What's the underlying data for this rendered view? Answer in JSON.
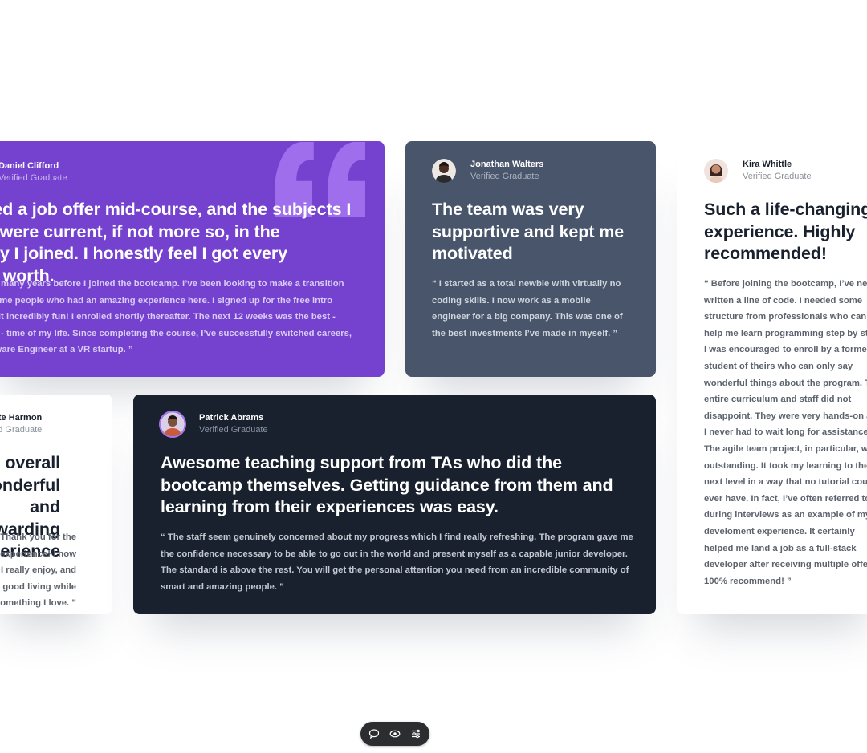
{
  "testimonials": {
    "daniel": {
      "name": "Daniel Clifford",
      "role": "Verified Graduate",
      "headline": "I received a job offer mid-course, and the subjects I learned were current, if not more so, in the company I joined. I honestly feel I got every penny’s worth.",
      "body": "“ I was an EMT for many years before I joined the bootcamp. I’ve been looking to make a transition and have heard some people who had an amazing experience here. I signed up for the free intro course and found it incredibly fun! I enrolled shortly thereafter. The next 12 weeks was the best - and most grueling - time of my life. Since completing the course, I’ve successfully switched careers, working as a Software Engineer at a VR startup. ”"
    },
    "jonathan": {
      "name": "Jonathan Walters",
      "role": "Verified Graduate",
      "headline": "The team was very supportive and kept me motivated",
      "body": "“ I started as a total newbie with virtually no coding skills. I now work as a mobile engineer for a big company. This was one of the best investments I’ve made in myself. ”"
    },
    "jeanette": {
      "name": "Jeanette Harmon",
      "role": "Verified Graduate",
      "headline": "An overall wonderful and rewarding experience",
      "body": "“ Thank you for the wonderful experience! I now have a job I really enjoy, and make a good living while doing something I love. ”"
    },
    "patrick": {
      "name": "Patrick Abrams",
      "role": "Verified Graduate",
      "headline": "Awesome teaching support from TAs who did the bootcamp themselves. Getting guidance from them and learning from their experiences was easy.",
      "body": "“ The staff seem genuinely concerned about my progress which I find really refreshing. The program gave me the confidence necessary to be able to go out in the world and present myself as a capable junior developer. The standard is above the rest. You will get the personal attention you need from an incredible community of smart and amazing people. ”"
    },
    "kira": {
      "name": "Kira Whittle",
      "role": "Verified Graduate",
      "headline": "Such a life-changing experience. Highly recommended!",
      "body": "“ Before joining the bootcamp, I’ve never written a line of code. I needed some structure from professionals who can help me learn programming step by step. I was encouraged to enroll by a former student of theirs who can only say wonderful things about the program. The entire curriculum and staff did not disappoint. They were very hands-on and I never had to wait long for assistance. The agile team project, in particular, was outstanding. It took my learning to the next level in a way that no tutorial could ever have. In fact, I’ve often referred to it during interviews as an example of my develoment experience. It certainly helped me land a job as a full-stack developer after receiving multiple offers. 100% recommend! ”"
    }
  },
  "colors": {
    "purple": "#7542cf",
    "gray_blue": "#48556a",
    "dark": "#19212e",
    "white": "#ffffff",
    "accent": "#a775f1"
  },
  "toolbar": {
    "icons": [
      "comment-icon",
      "eye-icon",
      "settings-icon"
    ]
  }
}
